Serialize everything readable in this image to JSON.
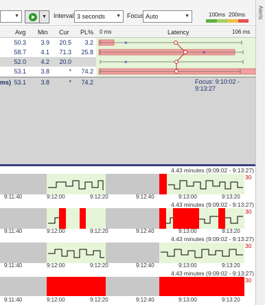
{
  "toolbar": {
    "interval_label": "Interval",
    "interval_value": "3 seconds",
    "focus_label": "Focus",
    "focus_value": "Auto",
    "legend_100": "100ms",
    "legend_200": "200ms",
    "legend_colors": [
      "#e85050",
      "#f0c040",
      "#a0d060",
      "#60b040"
    ]
  },
  "side_panel": {
    "label": "Alerts"
  },
  "table": {
    "headers": [
      "Avg",
      "Min",
      "Cur",
      "PL%"
    ],
    "latency_header": "Latency",
    "latency_min": "0 ms",
    "latency_max": "106 ms",
    "rows": [
      {
        "avg": "50.3",
        "min": "3.9",
        "cur": "20.5",
        "pl": "3.2"
      },
      {
        "avg": "58.7",
        "min": "4.1",
        "cur": "71.3",
        "pl": "25.8"
      },
      {
        "avg": "52.0",
        "min": "4.2",
        "cur": "20.0",
        "pl": ""
      },
      {
        "avg": "53.1",
        "min": "3.8",
        "cur": "*",
        "pl": "74.2"
      }
    ],
    "summary": {
      "prefix": "ms)",
      "avg": "53.1",
      "min": "3.8",
      "cur": "*",
      "pl": "74.2"
    },
    "focus_range": "Focus: 9:10:02 - 9:13:27"
  },
  "graphs": {
    "title": "4.43 minutes (9:09:02 - 9:13:27)",
    "max_value": "30",
    "ticks": [
      "9:11:40",
      "9:12:00",
      "9:12:20",
      "9:12:40",
      "9:13:00",
      "9:13:20"
    ],
    "colors": {
      "loss": "#ff0000",
      "ok": "#e6f5d8",
      "nodata": "#c8c8c8",
      "line": "#000000"
    }
  }
}
